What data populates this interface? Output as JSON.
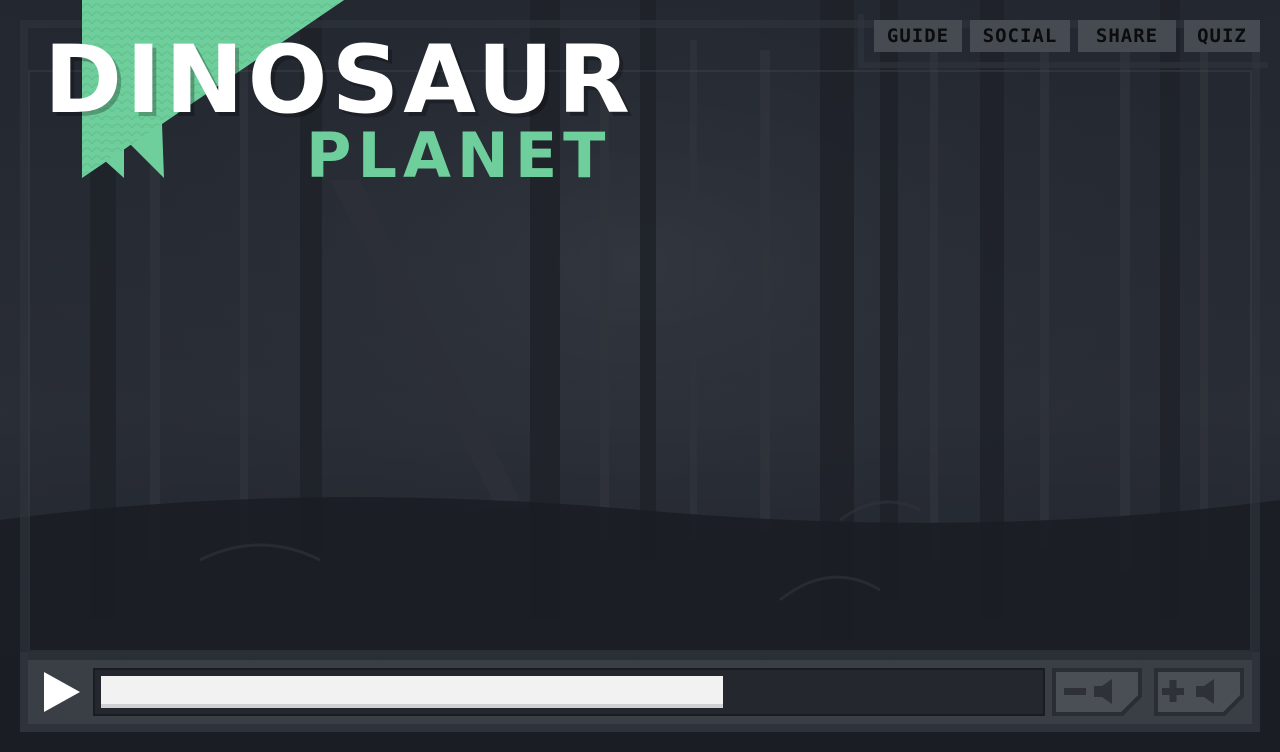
{
  "logo": {
    "title": "DINOSAUR",
    "subtitle": "PLANET",
    "accent_color": "#6fcf9c"
  },
  "nav": {
    "items": [
      {
        "label": "GUIDE"
      },
      {
        "label": "SOCIAL"
      },
      {
        "label": "SHARE"
      },
      {
        "label": "QUIZ"
      }
    ]
  },
  "background": {
    "scene": "dark-forest-image"
  },
  "player": {
    "play_icon": "play-icon",
    "volume_down_icon": "volume-down-icon",
    "volume_up_icon": "volume-up-icon",
    "progress_fraction": 0.665
  },
  "colors": {
    "background": "#1c1f27",
    "control_bar": "#3a3e45",
    "progress_fill": "#f2f2f2"
  }
}
